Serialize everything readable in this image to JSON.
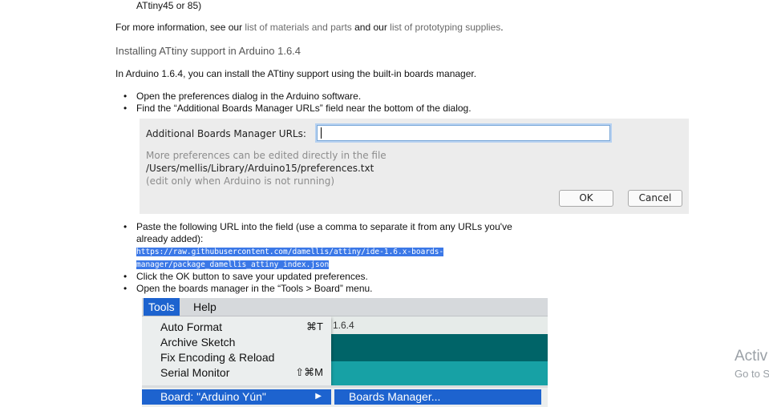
{
  "top_fragment": "ATtiny45 or 85)",
  "info": {
    "pre": "For more information, see our ",
    "link1": "list of materials and parts",
    "mid": " and our ",
    "link2": "list of prototyping supplies",
    "post": "."
  },
  "section_heading": "Installing ATtiny support in Arduino 1.6.4",
  "intro": "In Arduino 1.6.4, you can install the ATtiny support using the built-in boards manager.",
  "steps_a": [
    "Open the preferences dialog in the Arduino software.",
    "Find the “Additional Boards Manager URLs” field near the bottom of the dialog."
  ],
  "prefs_dialog": {
    "field_label": "Additional Boards Manager URLs:",
    "field_value": "",
    "note_line1": "More preferences can be edited directly in the file",
    "note_path": "/Users/mellis/Library/Arduino15/preferences.txt",
    "note_line3": "(edit only when Arduino is not running)",
    "ok_label": "OK",
    "cancel_label": "Cancel"
  },
  "steps_b": {
    "paste_line1": "Paste the following URL into the field (use a comma to separate it from any URLs you've",
    "paste_line2": "already added):",
    "url_line1": "https://raw.githubusercontent.com/damellis/attiny/ide-1.6.x-boards-",
    "url_line2": "manager/package_damellis_attiny_index.json",
    "click_ok": "Click the OK button to save your updated preferences.",
    "open_bm": "Open the boards manager in the “Tools > Board” menu."
  },
  "tools_menu": {
    "menubar": [
      "Tools",
      "Help"
    ],
    "version": "1.6.4",
    "items": [
      {
        "label": "Auto Format",
        "shortcut": "⌘T"
      },
      {
        "label": "Archive Sketch",
        "shortcut": ""
      },
      {
        "label": "Fix Encoding & Reload",
        "shortcut": ""
      },
      {
        "label": "Serial Monitor",
        "shortcut": "⇧⌘M"
      }
    ],
    "board_item": "Board: \"Arduino Yún\"",
    "submenu_arrow": "▶",
    "submenu_item": "Boards Manager..."
  },
  "watermark": {
    "line1": "Activ",
    "line2": "Go to S"
  },
  "colors": {
    "menu_highlight": "#1d63cf",
    "url_selection": "#3b78e7",
    "teal_dark": "#006468",
    "teal_light": "#17a1a5"
  }
}
